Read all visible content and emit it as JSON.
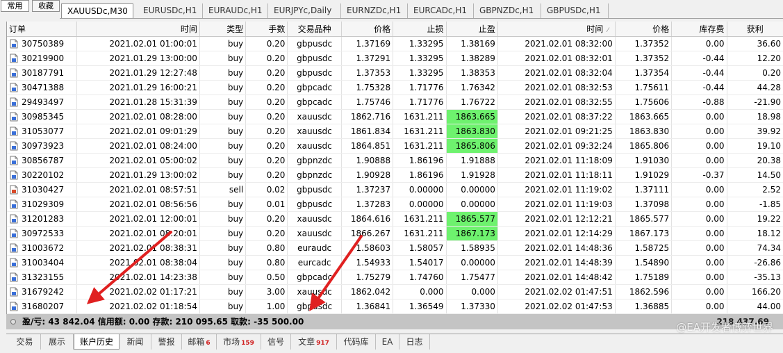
{
  "side_tabs": [
    "常用",
    "收藏"
  ],
  "chart_tabs": [
    "XAUUSDc,M30",
    "EURUSDc,H1",
    "EURAUDc,H1",
    "EURJPYc,Daily",
    "EURNZDc,H1",
    "EURCADc,H1",
    "GBPNZDc,H1",
    "GBPUSDc,H1"
  ],
  "columns": [
    "订单",
    "时间",
    "类型",
    "手数",
    "交易品种",
    "价格",
    "止损",
    "止盈",
    "时间",
    "价格",
    "库存费",
    "获利"
  ],
  "rows": [
    {
      "order": "30750389",
      "open_time": "2021.02.01 01:00:01",
      "type": "buy",
      "lots": "0.20",
      "symbol": "gbpusdc",
      "open_price": "1.37169",
      "sl": "1.33295",
      "tp": "1.38169",
      "close_time": "2021.02.01 08:32:00",
      "close_price": "1.37352",
      "swap": "0.00",
      "profit": "36.60",
      "tp_hit": false
    },
    {
      "order": "30219900",
      "open_time": "2021.01.29 13:00:00",
      "type": "buy",
      "lots": "0.20",
      "symbol": "gbpusdc",
      "open_price": "1.37291",
      "sl": "1.33295",
      "tp": "1.38289",
      "close_time": "2021.02.01 08:32:01",
      "close_price": "1.37352",
      "swap": "-0.44",
      "profit": "12.20",
      "tp_hit": false
    },
    {
      "order": "30187791",
      "open_time": "2021.01.29 12:27:48",
      "type": "buy",
      "lots": "0.20",
      "symbol": "gbpusdc",
      "open_price": "1.37353",
      "sl": "1.33295",
      "tp": "1.38353",
      "close_time": "2021.02.01 08:32:04",
      "close_price": "1.37354",
      "swap": "-0.44",
      "profit": "0.20",
      "tp_hit": false
    },
    {
      "order": "30471388",
      "open_time": "2021.01.29 16:00:21",
      "type": "buy",
      "lots": "0.20",
      "symbol": "gbpcadc",
      "open_price": "1.75328",
      "sl": "1.71776",
      "tp": "1.76342",
      "close_time": "2021.02.01 08:32:53",
      "close_price": "1.75611",
      "swap": "-0.44",
      "profit": "44.28",
      "tp_hit": false
    },
    {
      "order": "29493497",
      "open_time": "2021.01.28 15:31:39",
      "type": "buy",
      "lots": "0.20",
      "symbol": "gbpcadc",
      "open_price": "1.75746",
      "sl": "1.71776",
      "tp": "1.76722",
      "close_time": "2021.02.01 08:32:55",
      "close_price": "1.75606",
      "swap": "-0.88",
      "profit": "-21.90",
      "tp_hit": false
    },
    {
      "order": "30985345",
      "open_time": "2021.02.01 08:28:00",
      "type": "buy",
      "lots": "0.20",
      "symbol": "xauusdc",
      "open_price": "1862.716",
      "sl": "1631.211",
      "tp": "1863.665",
      "close_time": "2021.02.01 08:37:22",
      "close_price": "1863.665",
      "swap": "0.00",
      "profit": "18.98",
      "tp_hit": true
    },
    {
      "order": "31053077",
      "open_time": "2021.02.01 09:01:29",
      "type": "buy",
      "lots": "0.20",
      "symbol": "xauusdc",
      "open_price": "1861.834",
      "sl": "1631.211",
      "tp": "1863.830",
      "close_time": "2021.02.01 09:21:25",
      "close_price": "1863.830",
      "swap": "0.00",
      "profit": "39.92",
      "tp_hit": true
    },
    {
      "order": "30973923",
      "open_time": "2021.02.01 08:24:00",
      "type": "buy",
      "lots": "0.20",
      "symbol": "xauusdc",
      "open_price": "1864.851",
      "sl": "1631.211",
      "tp": "1865.806",
      "close_time": "2021.02.01 09:32:24",
      "close_price": "1865.806",
      "swap": "0.00",
      "profit": "19.10",
      "tp_hit": true
    },
    {
      "order": "30856787",
      "open_time": "2021.02.01 05:00:02",
      "type": "buy",
      "lots": "0.20",
      "symbol": "gbpnzdc",
      "open_price": "1.90888",
      "sl": "1.86196",
      "tp": "1.91888",
      "close_time": "2021.02.01 11:18:09",
      "close_price": "1.91030",
      "swap": "0.00",
      "profit": "20.38",
      "tp_hit": false
    },
    {
      "order": "30220102",
      "open_time": "2021.01.29 13:00:02",
      "type": "buy",
      "lots": "0.20",
      "symbol": "gbpnzdc",
      "open_price": "1.90928",
      "sl": "1.86196",
      "tp": "1.91928",
      "close_time": "2021.02.01 11:18:11",
      "close_price": "1.91029",
      "swap": "-0.37",
      "profit": "14.50",
      "tp_hit": false
    },
    {
      "order": "31030427",
      "open_time": "2021.02.01 08:57:51",
      "type": "sell",
      "lots": "0.02",
      "symbol": "gbpusdc",
      "open_price": "1.37237",
      "sl": "0.00000",
      "tp": "0.00000",
      "close_time": "2021.02.01 11:19:02",
      "close_price": "1.37111",
      "swap": "0.00",
      "profit": "2.52",
      "tp_hit": false
    },
    {
      "order": "31029309",
      "open_time": "2021.02.01 08:56:56",
      "type": "buy",
      "lots": "0.01",
      "symbol": "gbpusdc",
      "open_price": "1.37283",
      "sl": "0.00000",
      "tp": "0.00000",
      "close_time": "2021.02.01 11:19:03",
      "close_price": "1.37098",
      "swap": "0.00",
      "profit": "-1.85",
      "tp_hit": false
    },
    {
      "order": "31201283",
      "open_time": "2021.02.01 12:00:01",
      "type": "buy",
      "lots": "0.20",
      "symbol": "xauusdc",
      "open_price": "1864.616",
      "sl": "1631.211",
      "tp": "1865.577",
      "close_time": "2021.02.01 12:12:21",
      "close_price": "1865.577",
      "swap": "0.00",
      "profit": "19.22",
      "tp_hit": true
    },
    {
      "order": "30972533",
      "open_time": "2021.02.01 08:20:01",
      "type": "buy",
      "lots": "0.20",
      "symbol": "xauusdc",
      "open_price": "1866.267",
      "sl": "1631.211",
      "tp": "1867.173",
      "close_time": "2021.02.01 12:14:29",
      "close_price": "1867.173",
      "swap": "0.00",
      "profit": "18.12",
      "tp_hit": true
    },
    {
      "order": "31003672",
      "open_time": "2021.02.01 08:38:31",
      "type": "buy",
      "lots": "0.80",
      "symbol": "euraudc",
      "open_price": "1.58603",
      "sl": "1.58057",
      "tp": "1.58935",
      "close_time": "2021.02.01 14:48:36",
      "close_price": "1.58725",
      "swap": "0.00",
      "profit": "74.34",
      "tp_hit": false
    },
    {
      "order": "31003404",
      "open_time": "2021.02.01 08:38:04",
      "type": "buy",
      "lots": "0.80",
      "symbol": "eurcadc",
      "open_price": "1.54933",
      "sl": "1.54017",
      "tp": "0.00000",
      "close_time": "2021.02.01 14:48:39",
      "close_price": "1.54890",
      "swap": "0.00",
      "profit": "-26.86",
      "tp_hit": false
    },
    {
      "order": "31323155",
      "open_time": "2021.02.01 14:23:38",
      "type": "buy",
      "lots": "0.50",
      "symbol": "gbpcadc",
      "open_price": "1.75279",
      "sl": "1.74760",
      "tp": "1.75477",
      "close_time": "2021.02.01 14:48:42",
      "close_price": "1.75189",
      "swap": "0.00",
      "profit": "-35.13",
      "tp_hit": false
    },
    {
      "order": "31679242",
      "open_time": "2021.02.02 01:17:21",
      "type": "buy",
      "lots": "3.00",
      "symbol": "xauusdc",
      "open_price": "1862.042",
      "sl": "0.000",
      "tp": "0.000",
      "close_time": "2021.02.02 01:47:51",
      "close_price": "1862.596",
      "swap": "0.00",
      "profit": "166.20",
      "tp_hit": false
    },
    {
      "order": "31680207",
      "open_time": "2021.02.02 01:18:54",
      "type": "buy",
      "lots": "1.00",
      "symbol": "gbpusdc",
      "open_price": "1.36841",
      "sl": "1.36549",
      "tp": "1.37330",
      "close_time": "2021.02.02 01:47:53",
      "close_price": "1.36885",
      "swap": "0.00",
      "profit": "44.00",
      "tp_hit": false
    }
  ],
  "summary": {
    "text": "盈/亏: 43 842.04  信用额: 0.00  存款: 210 095.65  取款: -35 500.00",
    "total": "218 437.69"
  },
  "bottom_tabs": [
    {
      "label": "交易",
      "count": ""
    },
    {
      "label": "展示",
      "count": ""
    },
    {
      "label": "账户历史",
      "count": ""
    },
    {
      "label": "新闻",
      "count": ""
    },
    {
      "label": "警报",
      "count": ""
    },
    {
      "label": "邮箱",
      "count": "6"
    },
    {
      "label": "市场",
      "count": "159"
    },
    {
      "label": "信号",
      "count": ""
    },
    {
      "label": "文章",
      "count": "917"
    },
    {
      "label": "代码库",
      "count": ""
    },
    {
      "label": "EA",
      "count": ""
    },
    {
      "label": "日志",
      "count": ""
    }
  ],
  "watermark": "@EA开发者博弈世界",
  "colors": {
    "tp_hit_bg": "#6ef26e",
    "annotation_arrow": "#e02020",
    "buy_icon": "#3a6fd8",
    "sell_icon": "#d84a2a"
  }
}
